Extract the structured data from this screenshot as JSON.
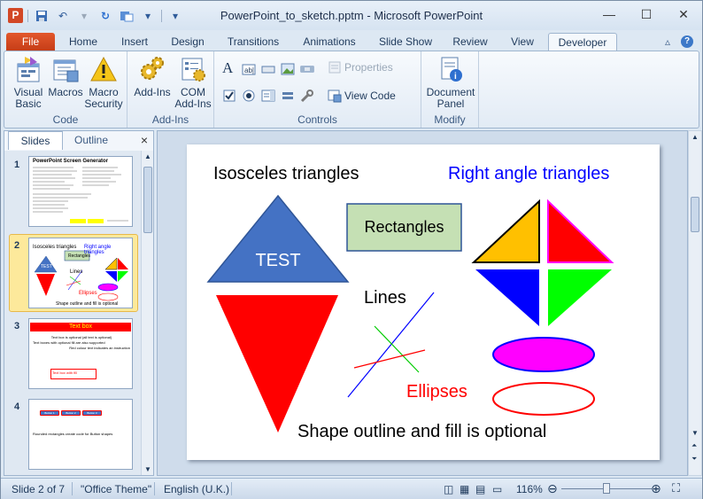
{
  "window": {
    "title": "PowerPoint_to_sketch.pptm - Microsoft PowerPoint",
    "app_icon": "P"
  },
  "tabs": [
    "File",
    "Home",
    "Insert",
    "Design",
    "Transitions",
    "Animations",
    "Slide Show",
    "Review",
    "View",
    "Developer"
  ],
  "active_tab": "Developer",
  "ribbon": {
    "code": {
      "label": "Code",
      "visual_basic": "Visual Basic",
      "visual_basic_l1": "Visual",
      "visual_basic_l2": "Basic",
      "macros": "Macros",
      "macro_security_l1": "Macro",
      "macro_security_l2": "Security"
    },
    "addins": {
      "label": "Add-Ins",
      "add_ins": "Add-Ins",
      "com_l1": "COM",
      "com_l2": "Add-Ins"
    },
    "controls": {
      "label": "Controls",
      "properties": "Properties",
      "view_code": "View Code"
    },
    "modify": {
      "label": "Modify",
      "doc_panel_l1": "Document",
      "doc_panel_l2": "Panel"
    }
  },
  "left_panel": {
    "tab_slides": "Slides",
    "tab_outline": "Outline",
    "close": "×",
    "slide_numbers": [
      "1",
      "2",
      "3",
      "4"
    ],
    "thumb1_title": "PowerPoint Screen Generator",
    "thumb2": {
      "iso": "Isosceles triangles",
      "right": "Right angle triangles",
      "rect": "Rectangles",
      "test": "TEST",
      "lines": "Lines",
      "ellipses": "Ellipses",
      "footer": "Shape outline and fill is optional"
    },
    "thumb3": {
      "title": "Text box",
      "line1": "Text box is optional (all text is optional)",
      "line2": "Text boxes with optional fill are also supported",
      "line3": "Red colour text indicates an instruction",
      "box": "Text box with fill"
    },
    "thumb4": {
      "b1": "Button 1",
      "b2": "Button 2",
      "b3": "Button 3",
      "caption": "Rounded rectangles create code for Button shapes"
    }
  },
  "slide": {
    "iso_title": "Isosceles triangles",
    "right_title": "Right angle triangles",
    "rect_label": "Rectangles",
    "test_label": "TEST",
    "lines_label": "Lines",
    "ellipses_label": "Ellipses",
    "footer": "Shape outline and fill is optional",
    "colors": {
      "blue_triangle": "#4472c4",
      "red": "#ff0000",
      "rect_fill": "#c5e0b4",
      "rect_stroke": "#2f5597",
      "orange": "#ffc000",
      "blue": "#0000ff",
      "green": "#00ff00",
      "magenta": "#ff00ff"
    }
  },
  "status": {
    "slide": "Slide 2 of 7",
    "theme": "\"Office Theme\"",
    "language": "English (U.K.)",
    "zoom": "116%"
  }
}
